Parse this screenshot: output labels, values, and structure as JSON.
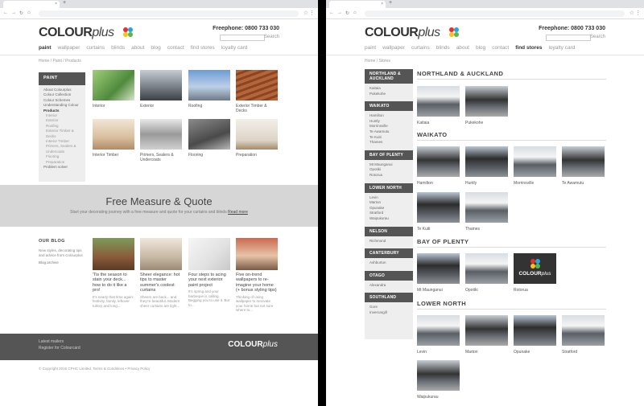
{
  "colors": {
    "dark": "#555555",
    "sidebar_bg": "#eeeeee",
    "band_bg": "#d6d6d6"
  },
  "site": {
    "logo_main": "COLOUR",
    "logo_plus": "plus",
    "freephone": "Freephone: 0800 733 030",
    "search_label": "Search",
    "nav": [
      "paint",
      "wallpaper",
      "curtains",
      "blinds",
      "about",
      "blog",
      "contact",
      "find stores",
      "loyalty card"
    ]
  },
  "left": {
    "breadcrumb": "Home  /  Paint  /  Products",
    "sidebar": {
      "heading": "PAINT",
      "items": [
        {
          "label": "About Colourplus",
          "style": ""
        },
        {
          "label": "Colour Collection",
          "style": ""
        },
        {
          "label": "Colour Schemes",
          "style": ""
        },
        {
          "label": "Understanding Colour",
          "style": ""
        },
        {
          "label": "Products",
          "style": "bold"
        },
        {
          "label": "Interior",
          "style": "sub"
        },
        {
          "label": "Exterior",
          "style": "sub"
        },
        {
          "label": "Roofing",
          "style": "sub"
        },
        {
          "label": "Exterior Timber & Decks",
          "style": "sub"
        },
        {
          "label": "Interior Timber",
          "style": "sub"
        },
        {
          "label": "Primers, Sealers & Undercoats",
          "style": "sub"
        },
        {
          "label": "Flooring",
          "style": "sub"
        },
        {
          "label": "Preparation",
          "style": "sub"
        },
        {
          "label": "Problem solver",
          "style": ""
        }
      ]
    },
    "products": [
      {
        "label": "Interior",
        "icon": "chair-photo"
      },
      {
        "label": "Exterior",
        "icon": "house-photo"
      },
      {
        "label": "Roofing",
        "icon": "roof-photo"
      },
      {
        "label": "Exterior Timber & Decks",
        "icon": "deck-photo"
      },
      {
        "label": "Interior Timber",
        "icon": "timber-photo"
      },
      {
        "label": "Primers, Sealers & Undercoats",
        "icon": "window-photo"
      },
      {
        "label": "Flooring",
        "icon": "floor-photo"
      },
      {
        "label": "Preparation",
        "icon": "boat-photo"
      }
    ],
    "promo": {
      "title": "Free Measure & Quote",
      "text": "Start your decorating journey with a free measure and quote for your curtains and blinds",
      "link": "Read more"
    },
    "blog": {
      "heading": "OUR BLOG",
      "desc": "New styles, decorating tips and advice from Colourplus",
      "archive": "Blog archive",
      "posts": [
        {
          "title": "'Tis the season to stain your deck... how to do it like a pro!",
          "excerpt": "It's nearly that time again: festivity, family, leftover turkey and long..."
        },
        {
          "title": "Sheer elegance: hot tips to master summer's coolest curtains",
          "excerpt": "Sheers are back... and they're beautiful. Modern sheer curtains are light..."
        },
        {
          "title": "Four steps to acing your next exterior paint project",
          "excerpt": "It's spring and your barbeque is calling. Begging you to use it. But to..."
        },
        {
          "title": "Five on-trend wallpapers to re-imagine your home (+ bonus styling tips)",
          "excerpt": "Thinking of using wallpaper to renovate your home but not sure where to..."
        }
      ]
    },
    "footer": {
      "line1": "Latest mailers",
      "line2": "Register for Colourcard",
      "copyright": "© Copyright 2016  CPHC Limited.   Terms & Conditions  •  Privacy Policy"
    }
  },
  "right": {
    "breadcrumb": "Home  /  Stores",
    "sidebar": [
      {
        "heading": "NORTHLAND & AUCKLAND",
        "items": [
          "Kaitaia",
          "Pukekohe"
        ]
      },
      {
        "heading": "WAIKATO",
        "items": [
          "Hamilton",
          "Huntly",
          "Morrinsville",
          "Te Awamutu",
          "Te Kuiti",
          "Thames"
        ]
      },
      {
        "heading": "BAY OF PLENTY",
        "items": [
          "Mt Maunganui",
          "Opotiki",
          "Rotorua"
        ]
      },
      {
        "heading": "LOWER NORTH",
        "items": [
          "Levin",
          "Marton",
          "Opunake",
          "Stratford",
          "Waipukurau"
        ]
      },
      {
        "heading": "NELSON",
        "items": [
          "Richmond"
        ]
      },
      {
        "heading": "CANTERBURY",
        "items": [
          "Ashburton"
        ]
      },
      {
        "heading": "OTAGO",
        "items": [
          "Alexandra"
        ]
      },
      {
        "heading": "SOUTHLAND",
        "items": [
          "Gore",
          "Invercargill"
        ]
      }
    ],
    "regions": [
      {
        "title": "NORTHLAND & AUCKLAND",
        "stores": [
          "Kaitaia",
          "Pukekohe"
        ]
      },
      {
        "title": "WAIKATO",
        "stores": [
          "Hamilton",
          "Huntly",
          "Morrinsville",
          "Te Awamutu",
          "Te Kuiti",
          "Thames"
        ]
      },
      {
        "title": "BAY OF PLENTY",
        "stores": [
          "Mt Maunganui",
          "Opotiki",
          "Rotorua"
        ]
      },
      {
        "title": "LOWER NORTH",
        "stores": [
          "Levin",
          "Marton",
          "Opunake",
          "Stratford",
          "Waipukurau"
        ]
      }
    ]
  }
}
